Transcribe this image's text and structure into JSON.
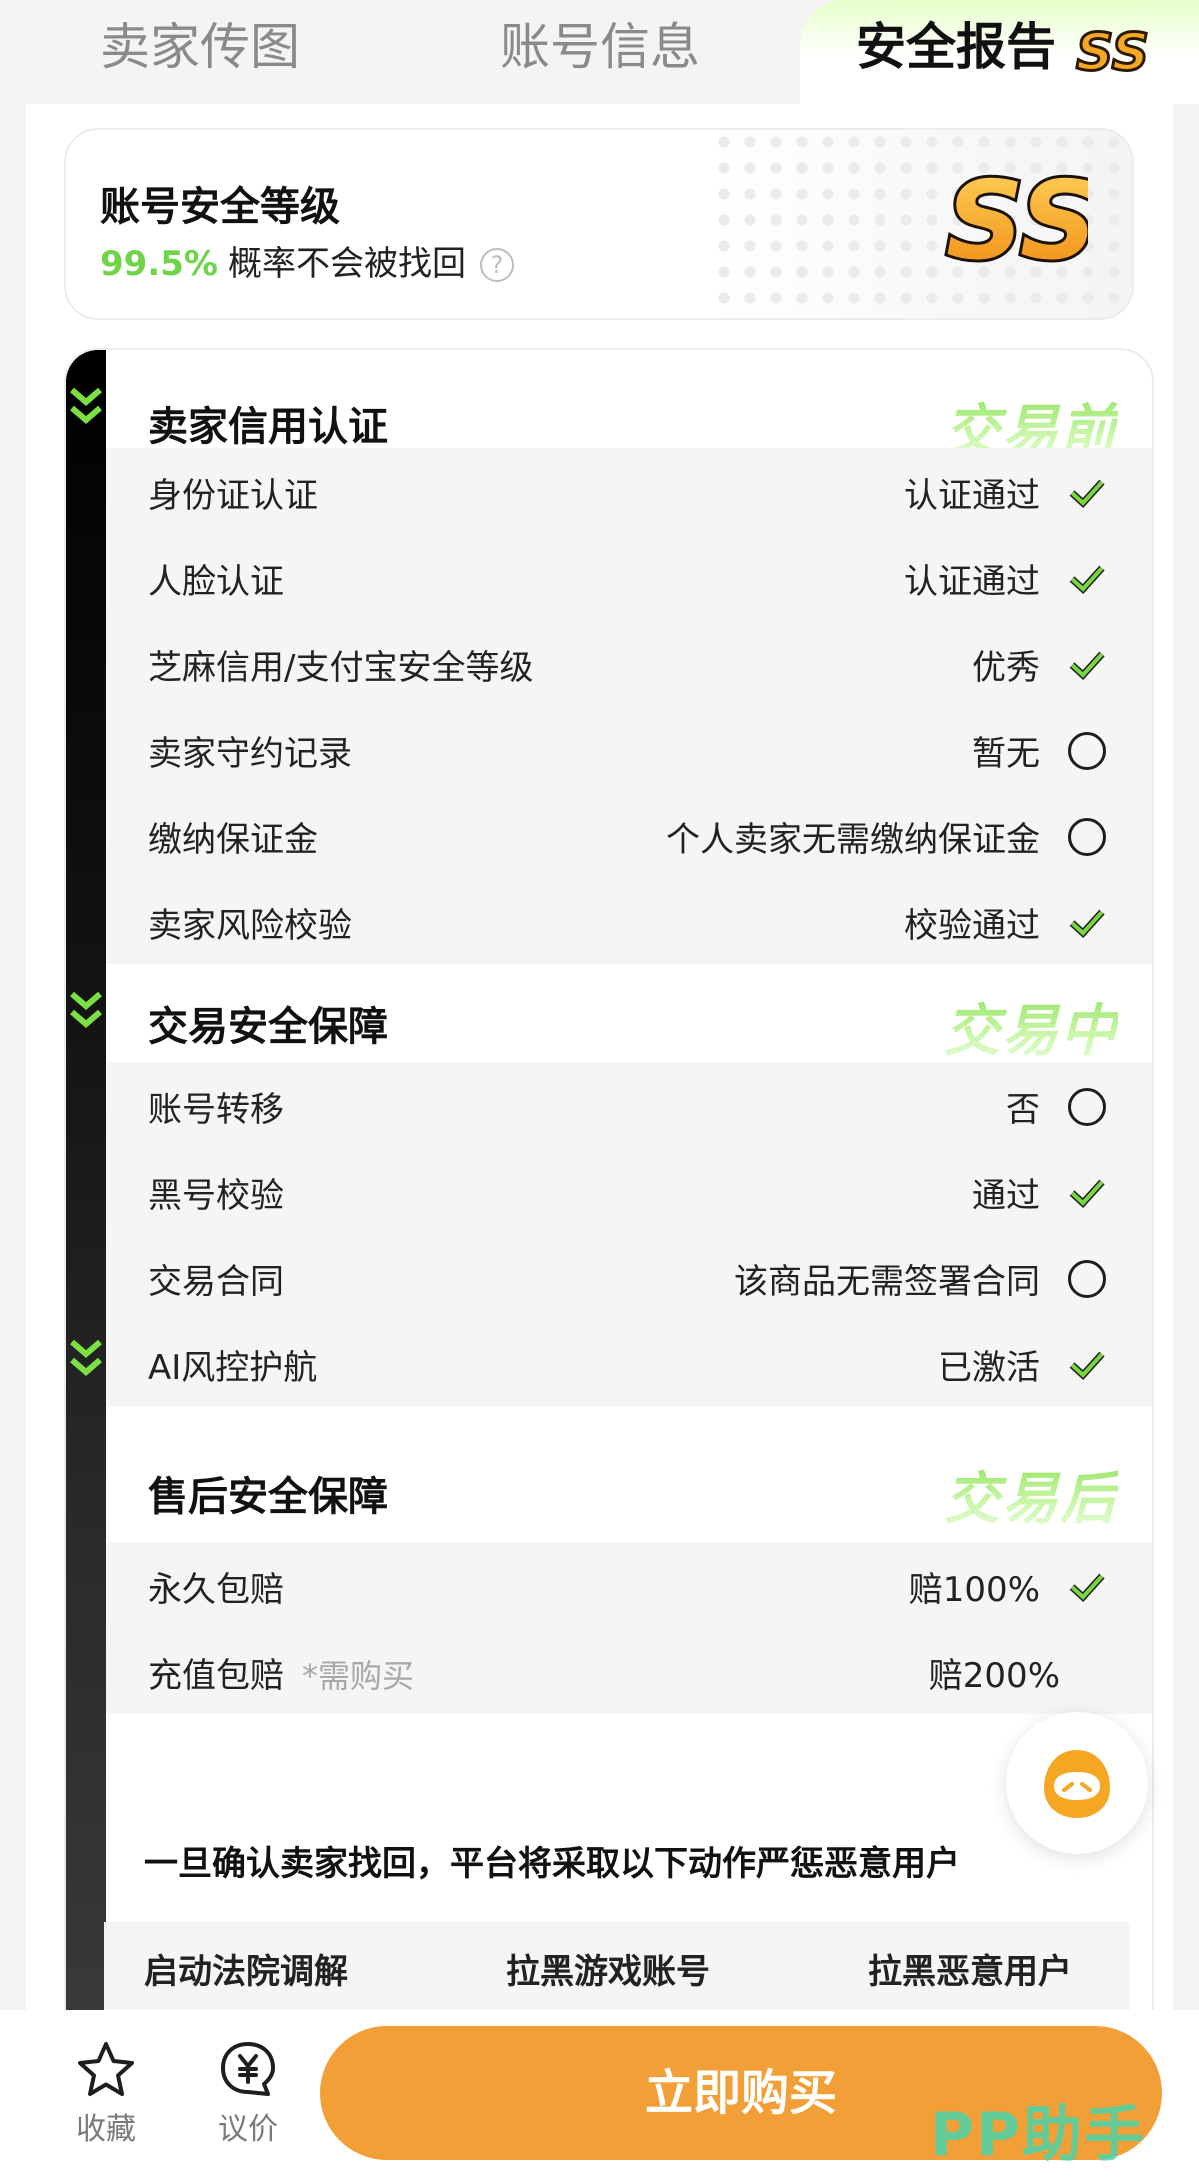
{
  "tabs": [
    {
      "label": "卖家传图"
    },
    {
      "label": "账号信息"
    },
    {
      "label": "安全报告",
      "badge": "SS"
    }
  ],
  "security_level": {
    "title": "账号安全等级",
    "percent": "99.5%",
    "description": "概率不会被找回",
    "help": "?",
    "grade": "SS"
  },
  "sections": [
    {
      "title": "卖家信用认证",
      "stage": "交易前",
      "rows": [
        {
          "label": "身份证认证",
          "value": "认证通过",
          "status": "check"
        },
        {
          "label": "人脸认证",
          "value": "认证通过",
          "status": "check"
        },
        {
          "label": "芝麻信用/支付宝安全等级",
          "value": "优秀",
          "status": "check"
        },
        {
          "label": "卖家守约记录",
          "value": "暂无",
          "status": "circle"
        },
        {
          "label": "缴纳保证金",
          "value": "个人卖家无需缴纳保证金",
          "status": "circle"
        },
        {
          "label": "卖家风险校验",
          "value": "校验通过",
          "status": "check"
        }
      ]
    },
    {
      "title": "交易安全保障",
      "stage": "交易中",
      "rows": [
        {
          "label": "账号转移",
          "value": "否",
          "status": "circle"
        },
        {
          "label": "黑号校验",
          "value": "通过",
          "status": "check"
        },
        {
          "label": "交易合同",
          "value": "该商品无需签署合同",
          "status": "circle"
        },
        {
          "label": "AI风控护航",
          "value": "已激活",
          "status": "check"
        }
      ]
    },
    {
      "title": "售后安全保障",
      "stage": "交易后",
      "rows": [
        {
          "label": "永久包赔",
          "value": "赔100%",
          "status": "check"
        },
        {
          "label": "充值包赔",
          "note": "*需购买",
          "value": "赔200%",
          "status": "none"
        }
      ]
    }
  ],
  "warning": "一旦确认卖家找回，平台将采取以下动作严惩恶意用户",
  "actions": [
    "启动法院调解",
    "拉黑游戏账号",
    "拉黑恶意用户"
  ],
  "bottom_bar": {
    "favorite_label": "收藏",
    "bargain_label": "议价",
    "buy_label": "立即购买"
  },
  "watermark": "PP助手",
  "colors": {
    "accent_green": "#6fd447",
    "check_green": "#7ad63f",
    "buy_orange": "#f29f38",
    "stage_green": "#9ce96b"
  }
}
